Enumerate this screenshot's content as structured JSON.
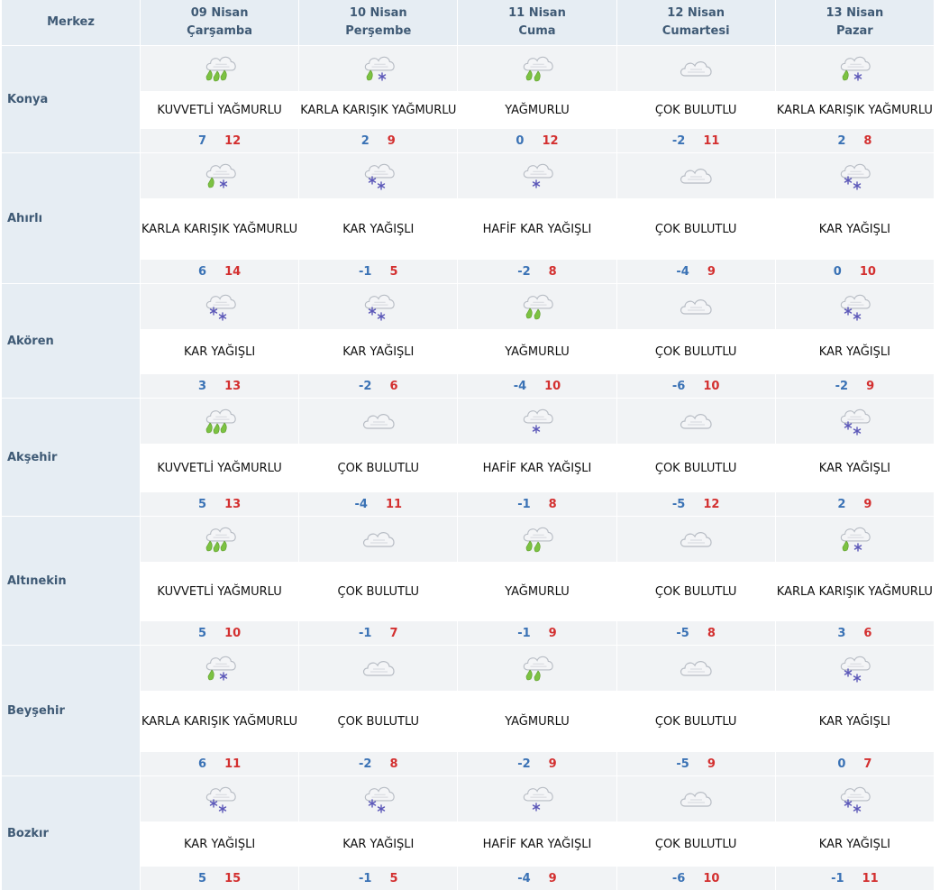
{
  "header": {
    "city_label": "Merkez",
    "days": [
      {
        "date": "09 Nisan",
        "weekday": "Çarşamba"
      },
      {
        "date": "10 Nisan",
        "weekday": "Perşembe"
      },
      {
        "date": "11 Nisan",
        "weekday": "Cuma"
      },
      {
        "date": "12 Nisan",
        "weekday": "Cumartesi"
      },
      {
        "date": "13 Nisan",
        "weekday": "Pazar"
      }
    ]
  },
  "conditions": {
    "kuvvetli": {
      "label": "KUVVETLİ YAĞMURLU",
      "icon": "heavy-rain-icon"
    },
    "karisik": {
      "label": "KARLA KARIŞIK YAĞMURLU",
      "icon": "sleet-icon"
    },
    "yagmurlu": {
      "label": "YAĞMURLU",
      "icon": "rain-icon"
    },
    "cokbulutlu": {
      "label": "ÇOK BULUTLU",
      "icon": "cloudy-icon"
    },
    "kar": {
      "label": "KAR YAĞIŞLI",
      "icon": "snow-icon"
    },
    "hafifkar": {
      "label": "HAFİF KAR YAĞIŞLI",
      "icon": "light-snow-icon"
    }
  },
  "colors": {
    "header_bg": "#e6edf3",
    "row_bg": "#f1f3f5",
    "min_temp": "#3a72b5",
    "max_temp": "#d32f2f",
    "city_text": "#3f5a75"
  },
  "rows": [
    {
      "city": "Konya",
      "days": [
        {
          "cond": "KUVVETLİ YAĞMURLU",
          "icon": "heavy-rain-icon",
          "min": "7",
          "max": "12"
        },
        {
          "cond": "KARLA KARIŞIK YAĞMURLU",
          "icon": "sleet-icon",
          "min": "2",
          "max": "9"
        },
        {
          "cond": "YAĞMURLU",
          "icon": "rain-icon",
          "min": "0",
          "max": "12"
        },
        {
          "cond": "ÇOK BULUTLU",
          "icon": "cloudy-icon",
          "min": "-2",
          "max": "11"
        },
        {
          "cond": "KARLA KARIŞIK YAĞMURLU",
          "icon": "sleet-icon",
          "min": "2",
          "max": "8"
        }
      ]
    },
    {
      "city": "Ahırlı",
      "days": [
        {
          "cond": "KARLA KARIŞIK YAĞMURLU",
          "icon": "sleet-icon",
          "min": "6",
          "max": "14"
        },
        {
          "cond": "KAR YAĞIŞLI",
          "icon": "snow-icon",
          "min": "-1",
          "max": "5"
        },
        {
          "cond": "HAFİF KAR YAĞIŞLI",
          "icon": "light-snow-icon",
          "min": "-2",
          "max": "8"
        },
        {
          "cond": "ÇOK BULUTLU",
          "icon": "cloudy-icon",
          "min": "-4",
          "max": "9"
        },
        {
          "cond": "KAR YAĞIŞLI",
          "icon": "snow-icon",
          "min": "0",
          "max": "10"
        }
      ]
    },
    {
      "city": "Akören",
      "days": [
        {
          "cond": "KAR YAĞIŞLI",
          "icon": "snow-icon",
          "min": "3",
          "max": "13"
        },
        {
          "cond": "KAR YAĞIŞLI",
          "icon": "snow-icon",
          "min": "-2",
          "max": "6"
        },
        {
          "cond": "YAĞMURLU",
          "icon": "rain-icon",
          "min": "-4",
          "max": "10"
        },
        {
          "cond": "ÇOK BULUTLU",
          "icon": "cloudy-icon",
          "min": "-6",
          "max": "10"
        },
        {
          "cond": "KAR YAĞIŞLI",
          "icon": "snow-icon",
          "min": "-2",
          "max": "9"
        }
      ]
    },
    {
      "city": "Akşehir",
      "days": [
        {
          "cond": "KUVVETLİ YAĞMURLU",
          "icon": "heavy-rain-icon",
          "min": "5",
          "max": "13"
        },
        {
          "cond": "ÇOK BULUTLU",
          "icon": "cloudy-icon",
          "min": "-4",
          "max": "11"
        },
        {
          "cond": "HAFİF KAR YAĞIŞLI",
          "icon": "light-snow-icon",
          "min": "-1",
          "max": "8"
        },
        {
          "cond": "ÇOK BULUTLU",
          "icon": "cloudy-icon",
          "min": "-5",
          "max": "12"
        },
        {
          "cond": "KAR YAĞIŞLI",
          "icon": "snow-icon",
          "min": "2",
          "max": "9"
        }
      ]
    },
    {
      "city": "Altınekin",
      "days": [
        {
          "cond": "KUVVETLİ YAĞMURLU",
          "icon": "heavy-rain-icon",
          "min": "5",
          "max": "10"
        },
        {
          "cond": "ÇOK BULUTLU",
          "icon": "cloudy-icon",
          "min": "-1",
          "max": "7"
        },
        {
          "cond": "YAĞMURLU",
          "icon": "rain-icon",
          "min": "-1",
          "max": "9"
        },
        {
          "cond": "ÇOK BULUTLU",
          "icon": "cloudy-icon",
          "min": "-5",
          "max": "8"
        },
        {
          "cond": "KARLA KARIŞIK YAĞMURLU",
          "icon": "sleet-icon",
          "min": "3",
          "max": "6"
        }
      ]
    },
    {
      "city": "Beyşehir",
      "days": [
        {
          "cond": "KARLA KARIŞIK YAĞMURLU",
          "icon": "sleet-icon",
          "min": "6",
          "max": "11"
        },
        {
          "cond": "ÇOK BULUTLU",
          "icon": "cloudy-icon",
          "min": "-2",
          "max": "8"
        },
        {
          "cond": "YAĞMURLU",
          "icon": "rain-icon",
          "min": "-2",
          "max": "9"
        },
        {
          "cond": "ÇOK BULUTLU",
          "icon": "cloudy-icon",
          "min": "-5",
          "max": "9"
        },
        {
          "cond": "KAR YAĞIŞLI",
          "icon": "snow-icon",
          "min": "0",
          "max": "7"
        }
      ]
    },
    {
      "city": "Bozkır",
      "days": [
        {
          "cond": "KAR YAĞIŞLI",
          "icon": "snow-icon",
          "min": "5",
          "max": "15"
        },
        {
          "cond": "KAR YAĞIŞLI",
          "icon": "snow-icon",
          "min": "-1",
          "max": "5"
        },
        {
          "cond": "HAFİF KAR YAĞIŞLI",
          "icon": "light-snow-icon",
          "min": "-4",
          "max": "9"
        },
        {
          "cond": "ÇOK BULUTLU",
          "icon": "cloudy-icon",
          "min": "-6",
          "max": "10"
        },
        {
          "cond": "KAR YAĞIŞLI",
          "icon": "snow-icon",
          "min": "-1",
          "max": "11"
        }
      ]
    }
  ]
}
